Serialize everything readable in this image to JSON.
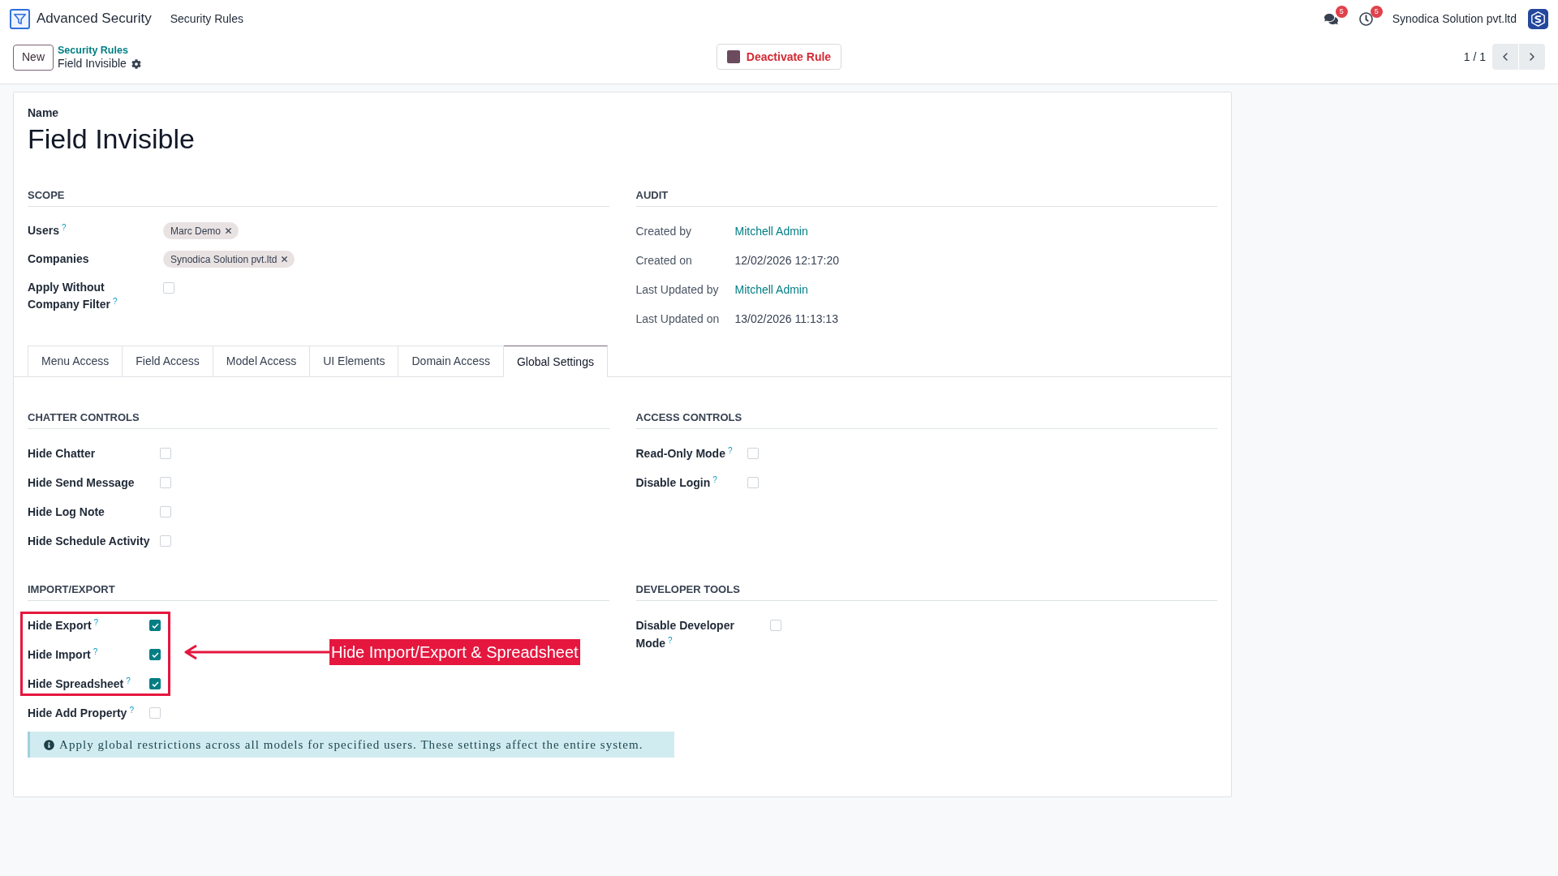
{
  "navbar": {
    "app_name": "Advanced Security",
    "menu": [
      {
        "label": "Security Rules"
      }
    ],
    "notifications": [
      {
        "kind": "messages",
        "count": "5"
      },
      {
        "kind": "activities",
        "count": "5"
      }
    ],
    "company": "Synodica Solution pvt.ltd"
  },
  "control_panel": {
    "new_button": "New",
    "breadcrumb": {
      "parent": "Security Rules",
      "current": "Field Invisible"
    },
    "action_button": "Deactivate Rule",
    "pager": "1 / 1"
  },
  "form": {
    "name_label": "Name",
    "name": "Field Invisible",
    "scope": {
      "title": "SCOPE",
      "fields": [
        {
          "kind": "tags",
          "label": "Users",
          "help": "?",
          "tags": [
            "Marc Demo"
          ]
        },
        {
          "kind": "tags",
          "label": "Companies",
          "tags": [
            "Synodica Solution pvt.ltd"
          ]
        },
        {
          "kind": "checkbox",
          "label": "Apply Without Company Filter",
          "help": "?",
          "checked": false
        }
      ]
    },
    "audit": {
      "title": "AUDIT",
      "fields": [
        {
          "kind": "link",
          "label": "Created by",
          "value": "Mitchell Admin"
        },
        {
          "kind": "text",
          "label": "Created on",
          "value": "12/02/2026 12:17:20"
        },
        {
          "kind": "link",
          "label": "Last Updated by",
          "value": "Mitchell Admin"
        },
        {
          "kind": "text",
          "label": "Last Updated on",
          "value": "13/02/2026 11:13:13"
        }
      ]
    },
    "tabs": [
      {
        "label": "Menu Access",
        "selected": false
      },
      {
        "label": "Field Access",
        "selected": false
      },
      {
        "label": "Model Access",
        "selected": false
      },
      {
        "label": "UI Elements",
        "selected": false
      },
      {
        "label": "Domain Access",
        "selected": false
      },
      {
        "label": "Global Settings",
        "selected": true
      }
    ],
    "sections": [
      {
        "title": "CHATTER CONTROLS",
        "fields": [
          {
            "label": "Hide Chatter",
            "checked": false
          },
          {
            "label": "Hide Send Message",
            "checked": false
          },
          {
            "label": "Hide Log Note",
            "checked": false
          },
          {
            "label": "Hide Schedule Activity",
            "checked": false
          }
        ]
      },
      {
        "title": "ACCESS CONTROLS",
        "fields": [
          {
            "label": "Read-Only Mode",
            "help": "?",
            "checked": false
          },
          {
            "label": "Disable Login",
            "help": "?",
            "checked": false
          }
        ]
      },
      {
        "title": "IMPORT/EXPORT",
        "callout": "Hide Import/Export & Spreadsheet",
        "fields": [
          {
            "label": "Hide Export",
            "help": "?",
            "checked": true,
            "highlighted": true
          },
          {
            "label": "Hide Import",
            "help": "?",
            "checked": true,
            "highlighted": true
          },
          {
            "label": "Hide Spreadsheet",
            "help": "?",
            "checked": true,
            "highlighted": true
          },
          {
            "label": "Hide Add Property",
            "help": "?",
            "checked": false,
            "highlighted": false
          }
        ]
      },
      {
        "title": "DEVELOPER TOOLS",
        "fields": [
          {
            "label": "Disable Developer Mode",
            "help": "?",
            "checked": false
          }
        ]
      }
    ],
    "info_alert": "Apply global restrictions across all models for specified users. These settings affect the entire system."
  }
}
